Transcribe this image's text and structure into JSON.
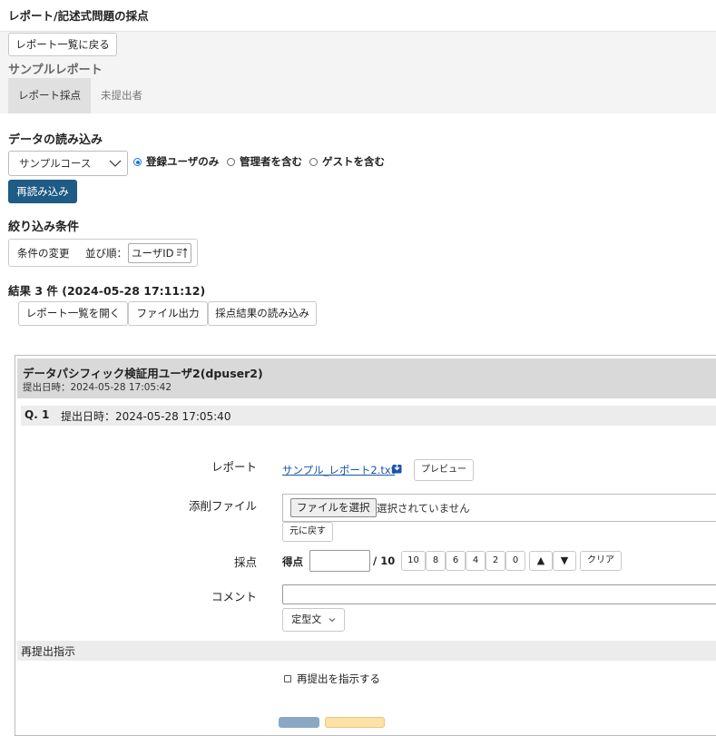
{
  "page": {
    "title": "レポート/記述式問題の採点",
    "back_button": "レポート一覧に戻る",
    "report_name": "サンプルレポート",
    "tabs": [
      {
        "label": "レポート採点",
        "active": true
      },
      {
        "label": "未提出者",
        "active": false
      }
    ]
  },
  "data_load": {
    "section_title": "データの読み込み",
    "course_select": "サンプルコース",
    "radios": [
      {
        "label": "登録ユーザのみ",
        "checked": true
      },
      {
        "label": "管理者を含む",
        "checked": false
      },
      {
        "label": "ゲストを含む",
        "checked": false
      }
    ],
    "reload_button": "再読み込み"
  },
  "filter": {
    "section_title": "絞り込み条件",
    "change_label": "条件の変更",
    "sort_label": "並び順：",
    "sort_value": "ユーザID"
  },
  "results": {
    "title": "結果 3 件 (2024-05-28 17:11:12)",
    "buttons": [
      "レポート一覧を開く",
      "ファイル出力",
      "採点結果の読み込み"
    ]
  },
  "submission": {
    "user_name": "データパシフィック検証用ユーザ2(dpuser2)",
    "submitted_at": "提出日時：2024-05-28 17:05:42",
    "question_label": "Q. 1",
    "question_submitted": "提出日時：2024-05-28 17:05:40",
    "report_label": "レポート",
    "file_link": "サンプル_レポート2.txt",
    "preview_button": "プレビュー",
    "correction_label": "添削ファイル",
    "choose_file_button": "ファイルを選択",
    "no_file_text": "選択されていません",
    "revert_button": "元に戻す",
    "score_label": "採点",
    "score_prefix": "得点",
    "score_value": "",
    "score_max": "/ 10",
    "quick_scores": [
      "10",
      "8",
      "6",
      "4",
      "2",
      "0"
    ],
    "up_button": "▲",
    "down_button": "▼",
    "clear_button": "クリア",
    "comment_label": "コメント",
    "comment_value": "",
    "template_button": "定型文",
    "resubmit_title": "再提出指示",
    "resubmit_checkbox": "再提出を指示する"
  },
  "colors": {
    "primary": "#1e5b85",
    "link": "#1a55a8",
    "header_gray": "#d9d9d9",
    "yellow_button": "#fbe2a6",
    "blue_button": "#8aa8c4"
  }
}
